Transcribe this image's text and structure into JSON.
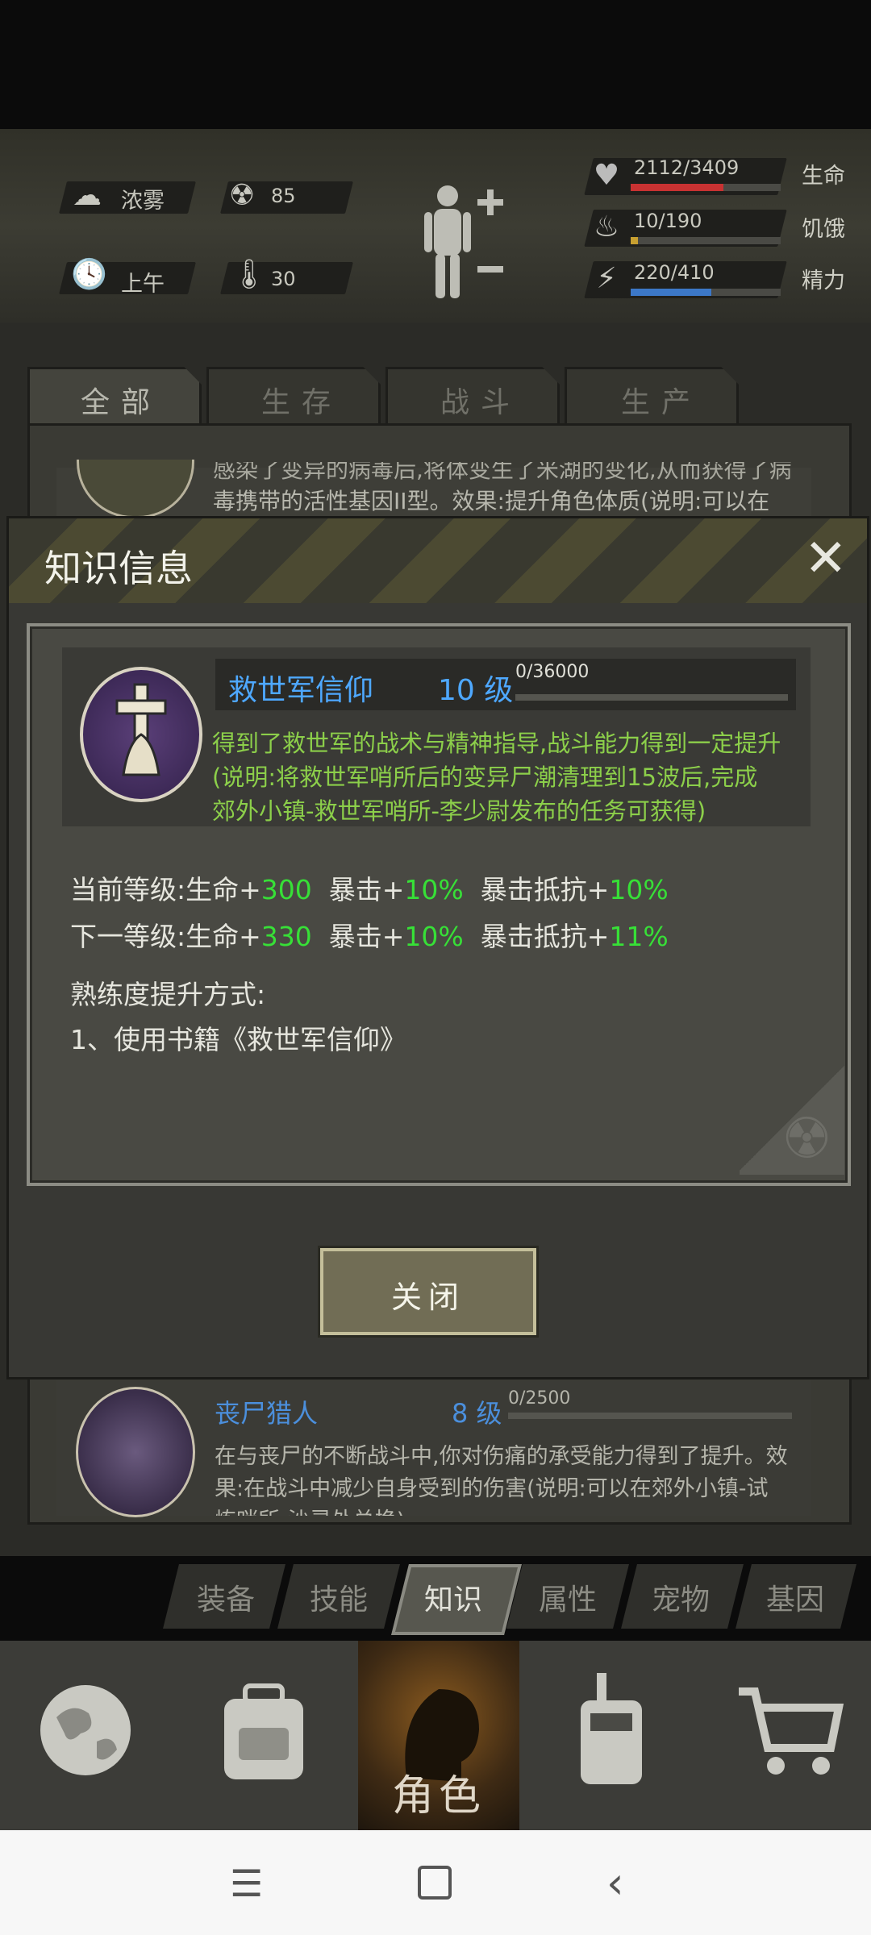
{
  "status": {
    "weather": "浓雾",
    "radiation": "85",
    "time_of_day": "上午",
    "temperature": "30",
    "life": {
      "value": "2112/3409",
      "label": "生命",
      "fraction": 0.62,
      "color": "#c83232"
    },
    "hunger": {
      "value": "10/190",
      "label": "饥饿",
      "fraction": 0.05,
      "color": "#c8a030"
    },
    "energy": {
      "value": "220/410",
      "label": "精力",
      "fraction": 0.54,
      "color": "#3c78c8"
    }
  },
  "tabs": [
    "全部",
    "生存",
    "战斗",
    "生产"
  ],
  "bg_card_text": {
    "line1": "感染了变异的病毒后,将体变生了米湖的变化,从而获得了病",
    "line2": "毒携带的活性基因II型。效果:提升角色体质(说明:可以在"
  },
  "dialog": {
    "title": "知识信息",
    "skill": {
      "name": "救世军信仰",
      "level": "10 级",
      "exp": "0/36000",
      "desc1": "得到了救世军的战术与精神指导,战斗能力得到一定提升",
      "desc2": "(说明:将救世军哨所后的变异尸潮清理到15波后,完成",
      "desc3": "郊外小镇-救世军哨所-李少尉发布的任务可获得)"
    },
    "current": {
      "prefix": "当前等级:",
      "life_lbl": "生命+",
      "life_val": "300",
      "crit_lbl": "暴击+",
      "crit_val": "10%",
      "res_lbl": "暴击抵抗+",
      "res_val": "10%"
    },
    "next": {
      "prefix": "下一等级:",
      "life_lbl": "生命+",
      "life_val": "330",
      "crit_lbl": "暴击+",
      "crit_val": "10%",
      "res_lbl": "暴击抵抗+",
      "res_val": "11%"
    },
    "method_title": "熟练度提升方式:",
    "method_1": "1、使用书籍《救世军信仰》",
    "close": "关闭"
  },
  "card2": {
    "name": "丧尸猎人",
    "level": "8 级",
    "exp": "0/2500",
    "desc1": "在与丧尸的不断战斗中,你对伤痛的承受能力得到了提升。效",
    "desc2": "果:在战斗中减少自身受到的伤害(说明:可以在郊外小镇-试",
    "desc3": "炼哨所-沙灵处兑换)"
  },
  "subtabs": [
    "装备",
    "技能",
    "知识",
    "属性",
    "宠物",
    "基因"
  ],
  "nav": {
    "active_label": "角色"
  }
}
